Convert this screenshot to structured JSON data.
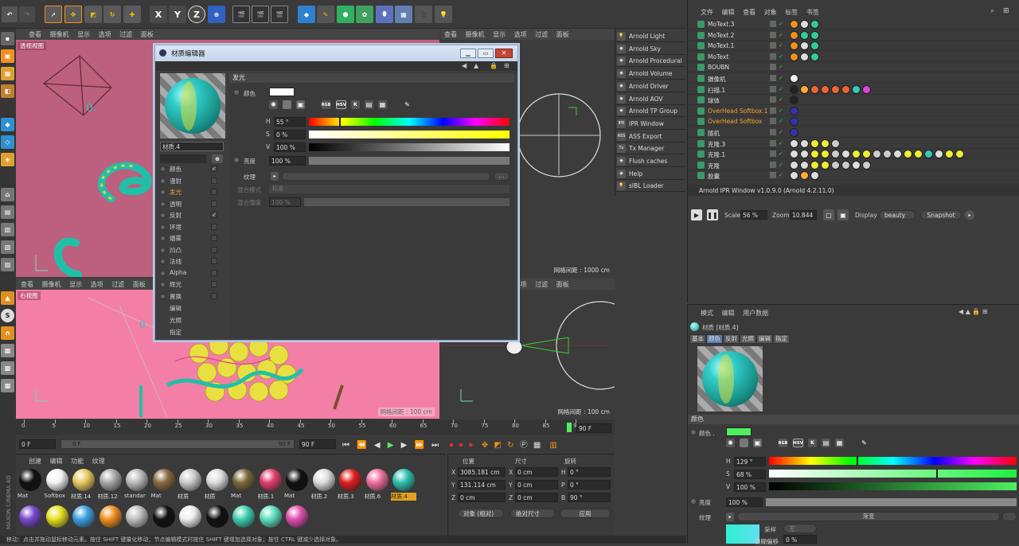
{
  "top_toolbar": {
    "axis_x": "X",
    "axis_y": "Y",
    "axis_z": "Z"
  },
  "viewports": {
    "menu": [
      "查看",
      "摄像机",
      "显示",
      "选项",
      "过滤",
      "面板"
    ],
    "perspective_label": "透视视图",
    "right_label": "右视图",
    "grid_top_right": "网格间距 : 1000 cm",
    "grid_bottom_left": "网格间距 : 100 cm",
    "grid_bottom_right": "网格间距 : 100 cm"
  },
  "material_editor": {
    "title": "材质编辑器",
    "mat_name": "材质.4",
    "section": "发光",
    "color_label": "颜色",
    "h_label": "H",
    "h_value": "55 °",
    "s_label": "S",
    "s_value": "0 %",
    "v_label": "V",
    "v_value": "100 %",
    "brightness_label": "亮度",
    "brightness_value": "100 %",
    "texture_label": "纹理",
    "blend_mode_label": "混合模式",
    "blend_mode_value": "标准",
    "blend_strength_label": "混合强度",
    "blend_strength_value": "100 %",
    "channels": [
      {
        "label": "颜色",
        "checked": true
      },
      {
        "label": "漫射",
        "checked": false
      },
      {
        "label": "发光",
        "checked": false
      },
      {
        "label": "透明",
        "checked": false
      },
      {
        "label": "反射",
        "checked": true
      },
      {
        "label": "环境",
        "checked": false
      },
      {
        "label": "烟雾",
        "checked": false
      },
      {
        "label": "凹凸",
        "checked": false
      },
      {
        "label": "法线",
        "checked": false
      },
      {
        "label": "Alpha",
        "checked": false
      },
      {
        "label": "辉光",
        "checked": false
      },
      {
        "label": "置换",
        "checked": false
      }
    ],
    "extra": [
      "编辑",
      "光照",
      "指定"
    ],
    "hsv_btn": "HSV",
    "k_btn": "K"
  },
  "arnold_menu": [
    "Arnold Light",
    "Arnold Sky",
    "Arnold Procedural",
    "Arnold Volume",
    "Arnold Driver",
    "Arnold AOV",
    "Arnold TP Group",
    "IPR Window",
    "ASS Export",
    "Tx Manager",
    "Flush caches",
    "Help",
    "sIBL Loader"
  ],
  "object_manager": {
    "menu": [
      "文件",
      "编辑",
      "查看",
      "对象",
      "标签",
      "书签"
    ],
    "objects": [
      "MoText.3",
      "MoText.2",
      "MoText.1",
      "MoText",
      "BOUBN",
      "摄像机",
      "扫描.1",
      "球体",
      "OverHead Softbox.1",
      "OverHead Softbox",
      "随机",
      "克隆.3",
      "克隆.1",
      "克隆",
      "胶囊"
    ]
  },
  "ipr": {
    "title": "Arnold IPR Window v1.0.9.0 (Arnold 4.2.11.0)",
    "scale_label": "Scale",
    "scale_value": "56 %",
    "zoom_label": "Zoom",
    "zoom_value": "10.844",
    "display_label": "Display",
    "display_value": "beauty",
    "snapshot": "Snapshot"
  },
  "attributes": {
    "menu": [
      "模式",
      "编辑",
      "用户数据"
    ],
    "title": "材质 [材质.4]",
    "tabs": [
      "基本",
      "颜色",
      "反射",
      "光照",
      "编辑",
      "指定"
    ],
    "section": "颜色",
    "color_label": "颜色 .",
    "h_label": "H",
    "h_value": "129 °",
    "s_label": "S",
    "s_value": "68 %",
    "v_label": "V",
    "v_value": "100 %",
    "brightness_label": "亮度",
    "brightness_value": "100 %",
    "texture_label": "纹理",
    "texture_value": "渐变",
    "sample_label": "采样",
    "sample_value": "无",
    "blur_label": "模糊偏移",
    "blur_value": "0 %"
  },
  "timeline": {
    "ticks": [
      "0",
      "5",
      "10",
      "15",
      "20",
      "25",
      "30",
      "35",
      "40",
      "45",
      "50",
      "55",
      "60",
      "65",
      "70",
      "75",
      "80",
      "85",
      "90"
    ],
    "frame_end": "90 F",
    "start_field": "0 F",
    "range_start": "0 F",
    "range_end": "90 F",
    "end_field": "90 F"
  },
  "material_browser": {
    "menu": [
      "创建",
      "编辑",
      "功能",
      "纹理"
    ],
    "row1": [
      {
        "name": "Mat",
        "color": "#111"
      },
      {
        "name": "Softbox",
        "color": "#f4f4f4"
      },
      {
        "name": "材质.14",
        "color": "#e8c860"
      },
      {
        "name": "材质.12",
        "color": "#aaa"
      },
      {
        "name": "standar",
        "color": "#bbb"
      },
      {
        "name": "Mat",
        "color": "#8a6a40"
      },
      {
        "name": "材质",
        "color": "#ccc"
      },
      {
        "name": "材质",
        "color": "#ddd"
      },
      {
        "name": "Mat",
        "color": "#7a6a3a"
      },
      {
        "name": "材质.1",
        "color": "#e04070"
      },
      {
        "name": "Mat",
        "color": "#111"
      },
      {
        "name": "材质.2",
        "color": "#ddd"
      },
      {
        "name": "材质.3",
        "color": "#e02020"
      },
      {
        "name": "材质.6",
        "color": "#f070a0"
      },
      {
        "name": "材质.4",
        "color": "#30c0b0"
      }
    ],
    "row2_colors": [
      "#7a4ad0",
      "#e8e020",
      "#40a0e0",
      "#f09020",
      "#c0c0c0",
      "#111",
      "#eee",
      "#111",
      "#40d0b0",
      "#60e0c0",
      "#e050b0"
    ]
  },
  "coords": {
    "headers": [
      "位置",
      "尺寸",
      "旋转"
    ],
    "rows": [
      {
        "axis": "X",
        "pos": "3085.181 cm",
        "size_axis": "X",
        "size": "0 cm",
        "rot_axis": "H",
        "rot": "0 °"
      },
      {
        "axis": "Y",
        "pos": "131.114 cm",
        "size_axis": "Y",
        "size": "0 cm",
        "rot_axis": "P",
        "rot": "0 °"
      },
      {
        "axis": "Z",
        "pos": "0 cm",
        "size_axis": "Z",
        "size": "0 cm",
        "rot_axis": "B",
        "rot": "90 °"
      }
    ],
    "mode": "对象 (相对)",
    "size_mode": "绝对尺寸",
    "apply": "应用"
  },
  "status": "移动：点击并拖动鼠标移动元素。按住 SHIFT 键量化移动；节点编辑模式时按住 SHIFT 键增加选择对象；按住 CTRL 键减少选择对象。",
  "brand": "MAXON CINEMA 4D"
}
